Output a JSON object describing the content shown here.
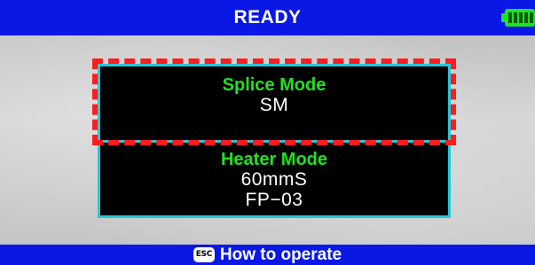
{
  "status_bar": {
    "title": "READY",
    "battery_icon": "battery-full-icon",
    "battery_color": "#22e022",
    "background_color": "#0a18e6"
  },
  "splice_mode": {
    "label": "Splice Mode",
    "value": "SM"
  },
  "heater_mode": {
    "label": "Heater Mode",
    "program": "60mmS",
    "sleeve": "FP−03"
  },
  "highlight": {
    "color": "#ff1c1c",
    "target": "splice_mode"
  },
  "footer": {
    "esc_icon": "esc-key-icon",
    "esc_label": "ESC",
    "hint": "How to operate"
  },
  "colors": {
    "accent_green": "#22e022",
    "card_border": "#25c7d9",
    "card_background": "#000000"
  }
}
